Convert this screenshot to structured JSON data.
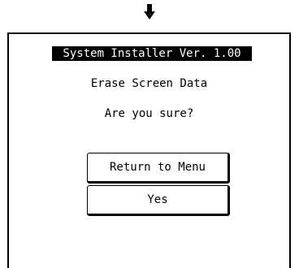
{
  "arrow_icon": "down-arrow-icon",
  "screen": {
    "title": "System Installer  Ver. 1.00",
    "message": "Erase Screen Data",
    "question": "Are you sure?",
    "buttons": {
      "return_label": "Return to Menu",
      "yes_label": "Yes"
    }
  }
}
